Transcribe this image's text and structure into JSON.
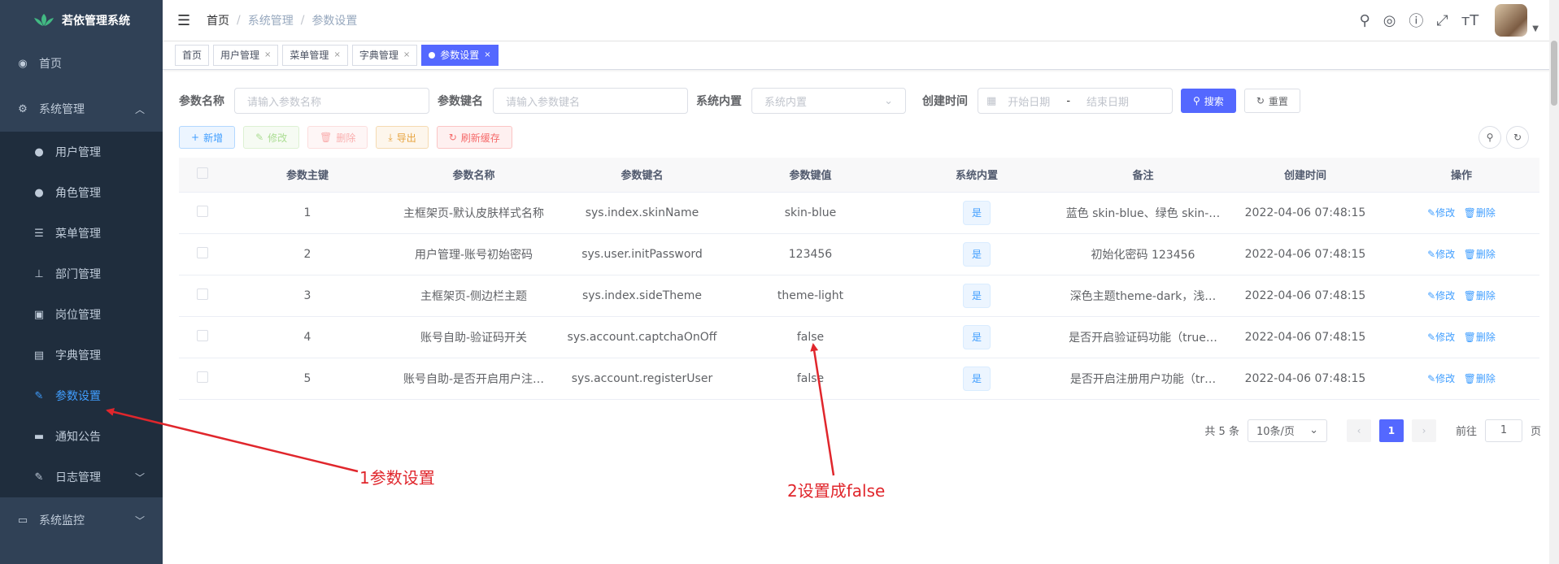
{
  "app": {
    "title": "若依管理系统"
  },
  "sidebar": {
    "items": [
      {
        "label": "首页",
        "icon": "dashboard-icon"
      },
      {
        "label": "系统管理",
        "icon": "system-icon"
      },
      {
        "label": "系统监控",
        "icon": "monitor-icon"
      }
    ],
    "sub_items": [
      {
        "label": "用户管理",
        "icon": "user-icon"
      },
      {
        "label": "角色管理",
        "icon": "peoples-icon"
      },
      {
        "label": "菜单管理",
        "icon": "tree-table-icon"
      },
      {
        "label": "部门管理",
        "icon": "tree-icon"
      },
      {
        "label": "岗位管理",
        "icon": "post-icon"
      },
      {
        "label": "字典管理",
        "icon": "dict-icon"
      },
      {
        "label": "参数设置",
        "icon": "edit-icon"
      },
      {
        "label": "通知公告",
        "icon": "message-icon"
      },
      {
        "label": "日志管理",
        "icon": "log-icon"
      }
    ],
    "active": "参数设置"
  },
  "breadcrumb": [
    "首页",
    "系统管理",
    "参数设置"
  ],
  "tags": [
    {
      "label": "首页"
    },
    {
      "label": "用户管理"
    },
    {
      "label": "菜单管理"
    },
    {
      "label": "字典管理"
    },
    {
      "label": "参数设置"
    }
  ],
  "search": {
    "config_name_label": "参数名称",
    "config_name_placeholder": "请输入参数名称",
    "config_key_label": "参数键名",
    "config_key_placeholder": "请输入参数键名",
    "config_type_label": "系统内置",
    "config_type_placeholder": "系统内置",
    "create_time_label": "创建时间",
    "start_placeholder": "开始日期",
    "range_separator": "-",
    "end_placeholder": "结束日期",
    "search_button": "搜索",
    "reset_button": "重置"
  },
  "toolbar": {
    "add": "新增",
    "edit": "修改",
    "delete": "删除",
    "export": "导出",
    "refresh_cache": "刷新缓存"
  },
  "table": {
    "headers": [
      "参数主键",
      "参数名称",
      "参数键名",
      "参数键值",
      "系统内置",
      "备注",
      "创建时间",
      "操作"
    ],
    "rows": [
      {
        "id": "1",
        "name": "主框架页-默认皮肤样式名称",
        "key": "sys.index.skinName",
        "value": "skin-blue",
        "builtin": "是",
        "remark": "蓝色 skin-blue、绿色 skin-…",
        "time": "2022-04-06 07:48:15"
      },
      {
        "id": "2",
        "name": "用户管理-账号初始密码",
        "key": "sys.user.initPassword",
        "value": "123456",
        "builtin": "是",
        "remark": "初始化密码 123456",
        "time": "2022-04-06 07:48:15"
      },
      {
        "id": "3",
        "name": "主框架页-侧边栏主题",
        "key": "sys.index.sideTheme",
        "value": "theme-light",
        "builtin": "是",
        "remark": "深色主题theme-dark，浅…",
        "time": "2022-04-06 07:48:15"
      },
      {
        "id": "4",
        "name": "账号自助-验证码开关",
        "key": "sys.account.captchaOnOff",
        "value": "false",
        "builtin": "是",
        "remark": "是否开启验证码功能（true…",
        "time": "2022-04-06 07:48:15"
      },
      {
        "id": "5",
        "name": "账号自助-是否开启用户注…",
        "key": "sys.account.registerUser",
        "value": "false",
        "builtin": "是",
        "remark": "是否开启注册用户功能（tr…",
        "time": "2022-04-06 07:48:15"
      }
    ],
    "edit_label": "修改",
    "delete_label": "删除"
  },
  "pagination": {
    "total": "共 5 条",
    "page_size": "10条/页",
    "current_page": "1",
    "goto_prefix": "前往",
    "goto_value": "1",
    "goto_suffix": "页"
  },
  "annotations": {
    "step1": "1参数设置",
    "step2": "2设置成false",
    "color": "#e0262c"
  }
}
